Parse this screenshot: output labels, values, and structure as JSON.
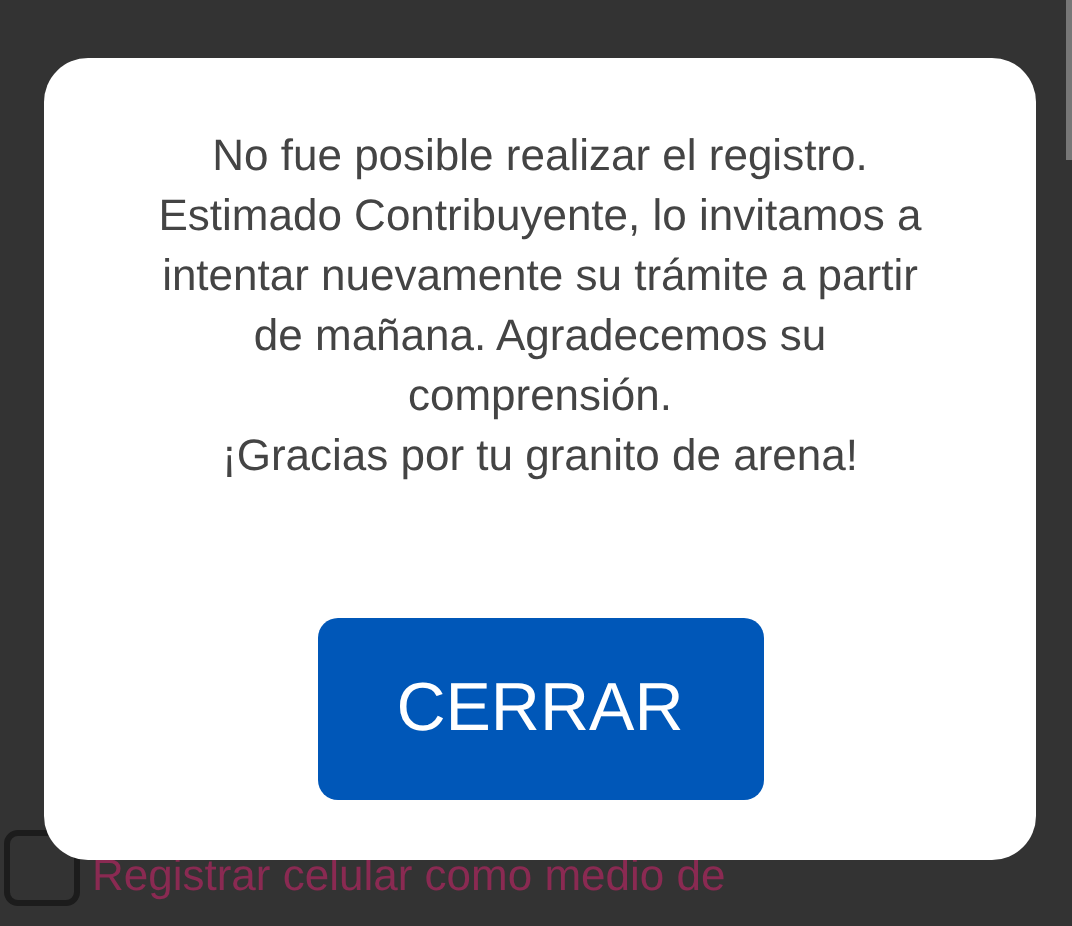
{
  "background": {
    "checkbox": {
      "label": "Registrar celular como medio de",
      "checked": false
    }
  },
  "dialog": {
    "message": "No fue posible realizar el registro.\nEstimado Contribuyente, lo invitamos a intentar nuevamente su trámite a partir de mañana. Agradecemos su comprensión.\n¡Gracias por tu granito de arena!",
    "button": "CERRAR"
  }
}
